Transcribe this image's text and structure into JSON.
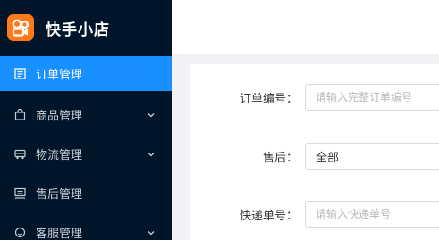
{
  "app": {
    "name": "快手小店",
    "logo_color": "#ff7a1a"
  },
  "sidebar": {
    "background": "#001529",
    "active_color": "#1890ff",
    "items": [
      {
        "label": "订单管理",
        "icon": "order-list-icon",
        "active": true,
        "has_submenu": false
      },
      {
        "label": "商品管理",
        "icon": "shopping-bag-icon",
        "active": false,
        "has_submenu": true
      },
      {
        "label": "物流管理",
        "icon": "truck-icon",
        "active": false,
        "has_submenu": true
      },
      {
        "label": "售后管理",
        "icon": "after-sale-icon",
        "active": false,
        "has_submenu": false
      },
      {
        "label": "客服管理",
        "icon": "customer-service-icon",
        "active": false,
        "has_submenu": true
      }
    ]
  },
  "filters": {
    "order_no": {
      "label": "订单编号：",
      "placeholder": "请输入完整订单编号",
      "value": ""
    },
    "after_sale": {
      "label": "售后：",
      "value": "全部"
    },
    "tracking_no": {
      "label": "快递单号：",
      "placeholder": "请输入快递单号",
      "value": ""
    }
  }
}
